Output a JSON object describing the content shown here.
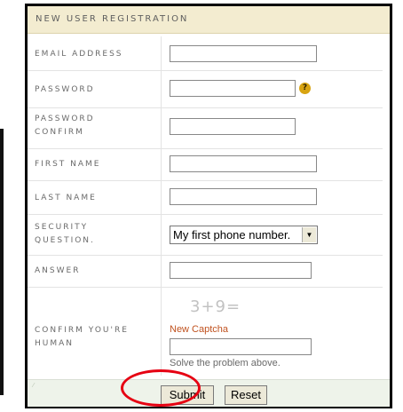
{
  "form": {
    "title": "NEW USER REGISTRATION",
    "fields": {
      "email": {
        "label": "EMAIL ADDRESS",
        "value": ""
      },
      "password": {
        "label": "PASSWORD",
        "value": "",
        "help_icon": "help-question-icon"
      },
      "password_confirm": {
        "label_line1": "PASSWORD",
        "label_line2": "CONFIRM",
        "value": ""
      },
      "first_name": {
        "label": "FIRST NAME",
        "value": ""
      },
      "last_name": {
        "label": "LAST NAME",
        "value": ""
      },
      "security_question": {
        "label_line1": "SECURITY",
        "label_line2": "QUESTION.",
        "selected": "My first phone number."
      },
      "answer": {
        "label": "ANSWER",
        "value": ""
      },
      "captcha": {
        "label_line1": "CONFIRM YOU'RE",
        "label_line2": "HUMAN",
        "challenge": "3+9=",
        "new_captcha_link": "New Captcha",
        "hint": "Solve the problem above.",
        "value": ""
      }
    },
    "buttons": {
      "submit_label": "Submit",
      "reset_label": "Reset"
    }
  },
  "colors": {
    "header_bg": "#f3ecd0",
    "button_row_bg": "#eef3ea",
    "highlight_circle": "#e60012",
    "captcha_link": "#c0521f"
  }
}
